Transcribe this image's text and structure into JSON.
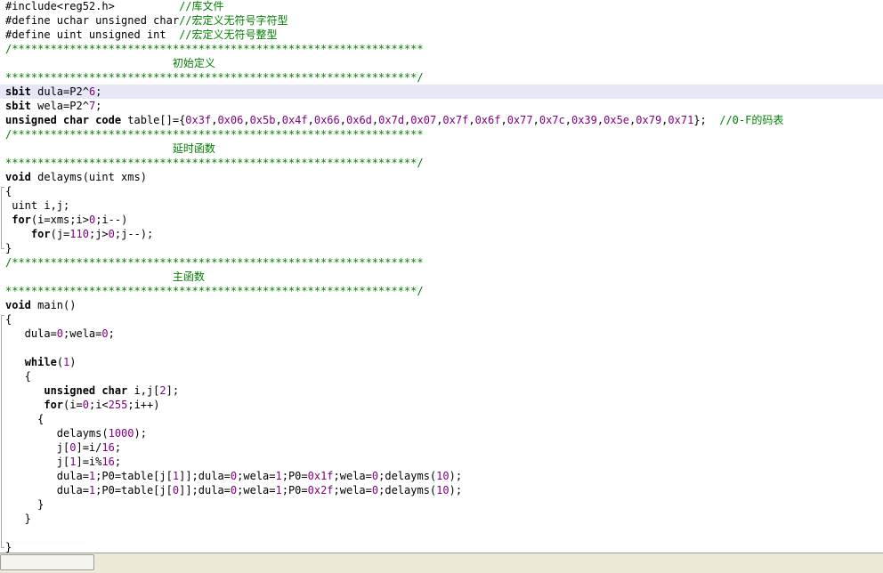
{
  "editor": {
    "current_line": 7,
    "lines": [
      {
        "fold": "",
        "segs": [
          [
            "pp",
            "#include<reg52.h>          "
          ],
          [
            "c",
            "//库文件"
          ]
        ]
      },
      {
        "fold": "",
        "segs": [
          [
            "pp",
            "#define uchar unsigned char"
          ],
          [
            "c",
            "//宏定义无符号字符型"
          ]
        ]
      },
      {
        "fold": "",
        "segs": [
          [
            "pp",
            "#define uint unsigned int  "
          ],
          [
            "c",
            "//宏定义无符号整型"
          ]
        ]
      },
      {
        "fold": "",
        "segs": [
          [
            "c",
            "/****************************************************************"
          ]
        ]
      },
      {
        "fold": "",
        "segs": [
          [
            "c",
            "                          初始定义"
          ]
        ]
      },
      {
        "fold": "",
        "segs": [
          [
            "c",
            "****************************************************************/"
          ]
        ]
      },
      {
        "fold": "",
        "segs": [
          [
            "k",
            "sbit"
          ],
          [
            "t",
            " dula=P2^"
          ],
          [
            "n",
            "6"
          ],
          [
            "t",
            ";"
          ]
        ]
      },
      {
        "fold": "",
        "segs": [
          [
            "k",
            "sbit"
          ],
          [
            "t",
            " wela=P2^"
          ],
          [
            "n",
            "7"
          ],
          [
            "t",
            ";"
          ]
        ]
      },
      {
        "fold": "",
        "segs": [
          [
            "k",
            "unsigned char code"
          ],
          [
            "t",
            " table[]={"
          ],
          [
            "n",
            "0x3f"
          ],
          [
            "t",
            ","
          ],
          [
            "n",
            "0x06"
          ],
          [
            "t",
            ","
          ],
          [
            "n",
            "0x5b"
          ],
          [
            "t",
            ","
          ],
          [
            "n",
            "0x4f"
          ],
          [
            "t",
            ","
          ],
          [
            "n",
            "0x66"
          ],
          [
            "t",
            ","
          ],
          [
            "n",
            "0x6d"
          ],
          [
            "t",
            ","
          ],
          [
            "n",
            "0x7d"
          ],
          [
            "t",
            ","
          ],
          [
            "n",
            "0x07"
          ],
          [
            "t",
            ","
          ],
          [
            "n",
            "0x7f"
          ],
          [
            "t",
            ","
          ],
          [
            "n",
            "0x6f"
          ],
          [
            "t",
            ","
          ],
          [
            "n",
            "0x77"
          ],
          [
            "t",
            ","
          ],
          [
            "n",
            "0x7c"
          ],
          [
            "t",
            ","
          ],
          [
            "n",
            "0x39"
          ],
          [
            "t",
            ","
          ],
          [
            "n",
            "0x5e"
          ],
          [
            "t",
            ","
          ],
          [
            "n",
            "0x79"
          ],
          [
            "t",
            ","
          ],
          [
            "n",
            "0x71"
          ],
          [
            "t",
            "};  "
          ],
          [
            "c",
            "//0-F的码表"
          ]
        ]
      },
      {
        "fold": "",
        "segs": [
          [
            "c",
            "/****************************************************************"
          ]
        ]
      },
      {
        "fold": "",
        "segs": [
          [
            "c",
            "                          延时函数"
          ]
        ]
      },
      {
        "fold": "",
        "segs": [
          [
            "c",
            "****************************************************************/"
          ]
        ]
      },
      {
        "fold": "",
        "segs": [
          [
            "k",
            "void"
          ],
          [
            "t",
            " delayms(uint xms)"
          ]
        ]
      },
      {
        "fold": "open",
        "segs": [
          [
            "t",
            "{"
          ]
        ]
      },
      {
        "fold": "mid",
        "segs": [
          [
            "t",
            " uint i,j;"
          ]
        ]
      },
      {
        "fold": "mid",
        "segs": [
          [
            "t",
            " "
          ],
          [
            "k",
            "for"
          ],
          [
            "t",
            "(i=xms;i>"
          ],
          [
            "n",
            "0"
          ],
          [
            "t",
            ";i--)"
          ]
        ]
      },
      {
        "fold": "mid",
        "segs": [
          [
            "t",
            "    "
          ],
          [
            "k",
            "for"
          ],
          [
            "t",
            "(j="
          ],
          [
            "n",
            "110"
          ],
          [
            "t",
            ";j>"
          ],
          [
            "n",
            "0"
          ],
          [
            "t",
            ";j--);"
          ]
        ]
      },
      {
        "fold": "close",
        "segs": [
          [
            "t",
            "}"
          ]
        ]
      },
      {
        "fold": "",
        "segs": [
          [
            "c",
            "/****************************************************************"
          ]
        ]
      },
      {
        "fold": "",
        "segs": [
          [
            "c",
            "                          主函数"
          ]
        ]
      },
      {
        "fold": "",
        "segs": [
          [
            "c",
            "****************************************************************/"
          ]
        ]
      },
      {
        "fold": "",
        "segs": [
          [
            "k",
            "void"
          ],
          [
            "t",
            " main()"
          ]
        ]
      },
      {
        "fold": "open",
        "segs": [
          [
            "t",
            "{"
          ]
        ]
      },
      {
        "fold": "mid",
        "segs": [
          [
            "t",
            "   dula="
          ],
          [
            "n",
            "0"
          ],
          [
            "t",
            ";wela="
          ],
          [
            "n",
            "0"
          ],
          [
            "t",
            ";"
          ]
        ]
      },
      {
        "fold": "mid",
        "segs": []
      },
      {
        "fold": "mid",
        "segs": [
          [
            "t",
            "   "
          ],
          [
            "k",
            "while"
          ],
          [
            "t",
            "("
          ],
          [
            "n",
            "1"
          ],
          [
            "t",
            ")"
          ]
        ]
      },
      {
        "fold": "mid",
        "segs": [
          [
            "t",
            "   {"
          ]
        ]
      },
      {
        "fold": "mid",
        "segs": [
          [
            "t",
            "      "
          ],
          [
            "k",
            "unsigned char"
          ],
          [
            "t",
            " i,j["
          ],
          [
            "n",
            "2"
          ],
          [
            "t",
            "];"
          ]
        ]
      },
      {
        "fold": "mid",
        "segs": [
          [
            "t",
            "      "
          ],
          [
            "k",
            "for"
          ],
          [
            "t",
            "(i="
          ],
          [
            "n",
            "0"
          ],
          [
            "t",
            ";i<"
          ],
          [
            "n",
            "255"
          ],
          [
            "t",
            ";i++)"
          ]
        ]
      },
      {
        "fold": "mid",
        "segs": [
          [
            "t",
            "     {"
          ]
        ]
      },
      {
        "fold": "mid",
        "segs": [
          [
            "t",
            "        delayms("
          ],
          [
            "n",
            "1000"
          ],
          [
            "t",
            ");"
          ]
        ]
      },
      {
        "fold": "mid",
        "segs": [
          [
            "t",
            "        j["
          ],
          [
            "n",
            "0"
          ],
          [
            "t",
            "]=i/"
          ],
          [
            "n",
            "16"
          ],
          [
            "t",
            ";"
          ]
        ]
      },
      {
        "fold": "mid",
        "segs": [
          [
            "t",
            "        j["
          ],
          [
            "n",
            "1"
          ],
          [
            "t",
            "]=i%"
          ],
          [
            "n",
            "16"
          ],
          [
            "t",
            ";"
          ]
        ]
      },
      {
        "fold": "mid",
        "segs": [
          [
            "t",
            "        dula="
          ],
          [
            "n",
            "1"
          ],
          [
            "t",
            ";P0=table[j["
          ],
          [
            "n",
            "1"
          ],
          [
            "t",
            "]];dula="
          ],
          [
            "n",
            "0"
          ],
          [
            "t",
            ";wela="
          ],
          [
            "n",
            "1"
          ],
          [
            "t",
            ";P0="
          ],
          [
            "n",
            "0x1f"
          ],
          [
            "t",
            ";wela="
          ],
          [
            "n",
            "0"
          ],
          [
            "t",
            ";delayms("
          ],
          [
            "n",
            "10"
          ],
          [
            "t",
            ");"
          ]
        ]
      },
      {
        "fold": "mid",
        "segs": [
          [
            "t",
            "        dula="
          ],
          [
            "n",
            "1"
          ],
          [
            "t",
            ";P0=table[j["
          ],
          [
            "n",
            "0"
          ],
          [
            "t",
            "]];dula="
          ],
          [
            "n",
            "0"
          ],
          [
            "t",
            ";wela="
          ],
          [
            "n",
            "1"
          ],
          [
            "t",
            ";P0="
          ],
          [
            "n",
            "0x2f"
          ],
          [
            "t",
            ";wela="
          ],
          [
            "n",
            "0"
          ],
          [
            "t",
            ";delayms("
          ],
          [
            "n",
            "10"
          ],
          [
            "t",
            ");"
          ]
        ]
      },
      {
        "fold": "mid",
        "segs": [
          [
            "t",
            "     }"
          ]
        ]
      },
      {
        "fold": "mid",
        "segs": [
          [
            "t",
            "   }"
          ]
        ]
      },
      {
        "fold": "mid",
        "segs": []
      },
      {
        "fold": "close",
        "segs": [
          [
            "t",
            "}"
          ]
        ]
      }
    ]
  }
}
